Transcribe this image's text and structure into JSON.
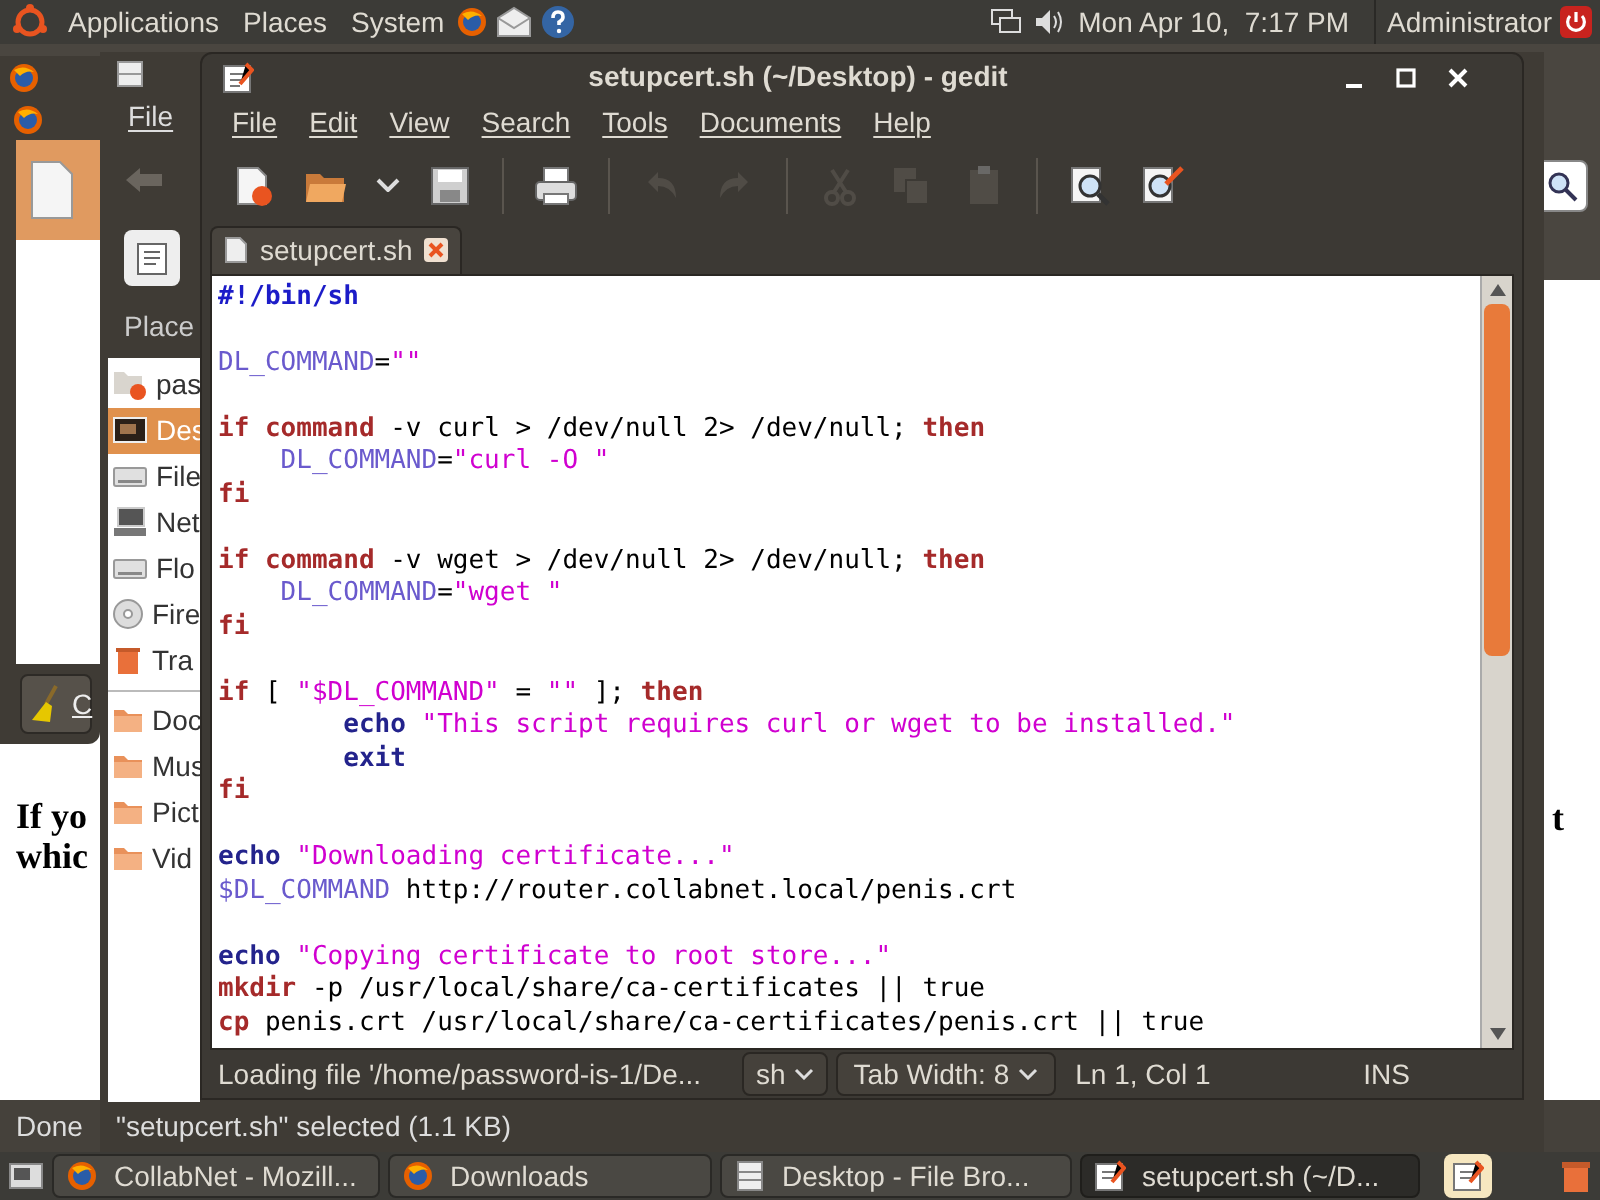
{
  "top_panel": {
    "menus": [
      "Applications",
      "Places",
      "System"
    ],
    "clock": "Mon Apr 10,  7:17 PM",
    "user": "Administrator"
  },
  "browser": {
    "page_text": [
      "If yo",
      "whic"
    ],
    "page_text_right": "t",
    "status": "Done"
  },
  "downloads": {
    "clear_button": "C"
  },
  "file_browser": {
    "menu": "File",
    "places_header": "Place",
    "places": [
      {
        "label": "pas",
        "kind": "home",
        "selected": false
      },
      {
        "label": "Des",
        "kind": "desktop",
        "selected": true
      },
      {
        "label": "File",
        "kind": "drive",
        "selected": false
      },
      {
        "label": "Net",
        "kind": "network",
        "selected": false
      },
      {
        "label": "Flo",
        "kind": "drive",
        "selected": false
      },
      {
        "label": "Fire",
        "kind": "disc",
        "selected": false
      },
      {
        "label": "Tra",
        "kind": "trash",
        "selected": false
      },
      {
        "label": "Doc",
        "kind": "folder",
        "selected": false
      },
      {
        "label": "Mus",
        "kind": "folder",
        "selected": false
      },
      {
        "label": "Pict",
        "kind": "folder",
        "selected": false
      },
      {
        "label": "Vid",
        "kind": "folder",
        "selected": false
      }
    ],
    "status": "\"setupcert.sh\" selected (1.1 KB)"
  },
  "gedit": {
    "title": "setupcert.sh (~/Desktop) - gedit",
    "menus": [
      "File",
      "Edit",
      "View",
      "Search",
      "Tools",
      "Documents",
      "Help"
    ],
    "toolbar": [
      [
        {
          "kind": "new",
          "disabled": false
        },
        {
          "kind": "open",
          "disabled": false
        },
        {
          "kind": "recent",
          "disabled": false
        },
        {
          "kind": "save",
          "disabled": false
        }
      ],
      [
        {
          "kind": "print",
          "disabled": false
        }
      ],
      [
        {
          "kind": "undo",
          "disabled": true
        },
        {
          "kind": "redo",
          "disabled": true
        }
      ],
      [
        {
          "kind": "cut",
          "disabled": true
        },
        {
          "kind": "copy",
          "disabled": true
        },
        {
          "kind": "paste",
          "disabled": true
        }
      ],
      [
        {
          "kind": "find",
          "disabled": false
        },
        {
          "kind": "replace",
          "disabled": false
        }
      ]
    ],
    "tabs": [
      {
        "label": "setupcert.sh",
        "selected": true
      }
    ],
    "lines": [
      {
        "space_before": false,
        "segments": [
          {
            "kind": "shebang",
            "text": "#!/bin/sh"
          }
        ]
      },
      {
        "space_before": true,
        "segments": [
          {
            "kind": "variable",
            "text": "DL_COMMAND"
          },
          {
            "kind": "plain",
            "text": "="
          },
          {
            "kind": "string",
            "text": "\"\""
          }
        ]
      },
      {
        "space_before": true,
        "segments": [
          {
            "kind": "keyword",
            "text": "if "
          },
          {
            "kind": "keyword",
            "text": "command"
          },
          {
            "kind": "plain",
            "text": " -v curl > /dev/null 2> /dev/null; "
          },
          {
            "kind": "keyword",
            "text": "then"
          }
        ]
      },
      {
        "space_before": false,
        "segments": [
          {
            "kind": "variable",
            "text": "    DL_COMMAND"
          },
          {
            "kind": "plain",
            "text": "="
          },
          {
            "kind": "string",
            "text": "\"curl -O \""
          }
        ]
      },
      {
        "space_before": false,
        "segments": [
          {
            "kind": "keyword",
            "text": "fi"
          }
        ]
      },
      {
        "space_before": true,
        "segments": [
          {
            "kind": "keyword",
            "text": "if "
          },
          {
            "kind": "keyword",
            "text": "command"
          },
          {
            "kind": "plain",
            "text": " -v wget > /dev/null 2> /dev/null; "
          },
          {
            "kind": "keyword",
            "text": "then"
          }
        ]
      },
      {
        "space_before": false,
        "segments": [
          {
            "kind": "variable",
            "text": "    DL_COMMAND"
          },
          {
            "kind": "plain",
            "text": "="
          },
          {
            "kind": "string",
            "text": "\"wget \""
          }
        ]
      },
      {
        "space_before": false,
        "segments": [
          {
            "kind": "keyword",
            "text": "fi"
          }
        ]
      },
      {
        "space_before": true,
        "segments": [
          {
            "kind": "keyword",
            "text": "if"
          },
          {
            "kind": "plain",
            "text": " [ "
          },
          {
            "kind": "string",
            "text": "\"$DL_COMMAND\""
          },
          {
            "kind": "plain",
            "text": " = "
          },
          {
            "kind": "string",
            "text": "\"\""
          },
          {
            "kind": "plain",
            "text": " ]; "
          },
          {
            "kind": "keyword",
            "text": "then"
          }
        ]
      },
      {
        "space_before": false,
        "segments": [
          {
            "kind": "builtin",
            "text": "        echo "
          },
          {
            "kind": "string",
            "text": "\"This script requires curl or wget to be installed.\""
          }
        ]
      },
      {
        "space_before": false,
        "segments": [
          {
            "kind": "builtin",
            "text": "        exit"
          }
        ]
      },
      {
        "space_before": false,
        "segments": [
          {
            "kind": "keyword",
            "text": "fi"
          }
        ]
      },
      {
        "space_before": true,
        "segments": [
          {
            "kind": "builtin",
            "text": "echo "
          },
          {
            "kind": "string",
            "text": "\"Downloading certificate...\""
          }
        ]
      },
      {
        "space_before": false,
        "segments": [
          {
            "kind": "variable",
            "text": "$DL_COMMAND"
          },
          {
            "kind": "plain",
            "text": " http://router.collabnet.local/penis.crt"
          }
        ]
      },
      {
        "space_before": true,
        "segments": [
          {
            "kind": "builtin",
            "text": "echo "
          },
          {
            "kind": "string",
            "text": "\"Copying certificate to root store...\""
          }
        ]
      },
      {
        "space_before": false,
        "segments": [
          {
            "kind": "keyword",
            "text": "mkdir"
          },
          {
            "kind": "plain",
            "text": " -p /usr/local/share/ca-certificates || true"
          }
        ]
      },
      {
        "space_before": false,
        "segments": [
          {
            "kind": "keyword",
            "text": "cp"
          },
          {
            "kind": "plain",
            "text": " penis.crt /usr/local/share/ca-certificates/penis.crt || true"
          }
        ]
      }
    ],
    "status": {
      "message": "Loading file '/home/password-is-1/De...",
      "language": "sh",
      "tab_width": "Tab Width: 8",
      "position": "Ln 1, Col 1",
      "mode": "INS"
    }
  },
  "taskbar": {
    "items": [
      {
        "label": "CollabNet - Mozill...",
        "kind": "browser",
        "selected": false
      },
      {
        "label": "Downloads",
        "kind": "browser",
        "selected": false
      },
      {
        "label": "Desktop - File Bro...",
        "kind": "files",
        "selected": false
      },
      {
        "label": "setupcert.sh (~/D...",
        "kind": "editor",
        "selected": true
      }
    ]
  }
}
